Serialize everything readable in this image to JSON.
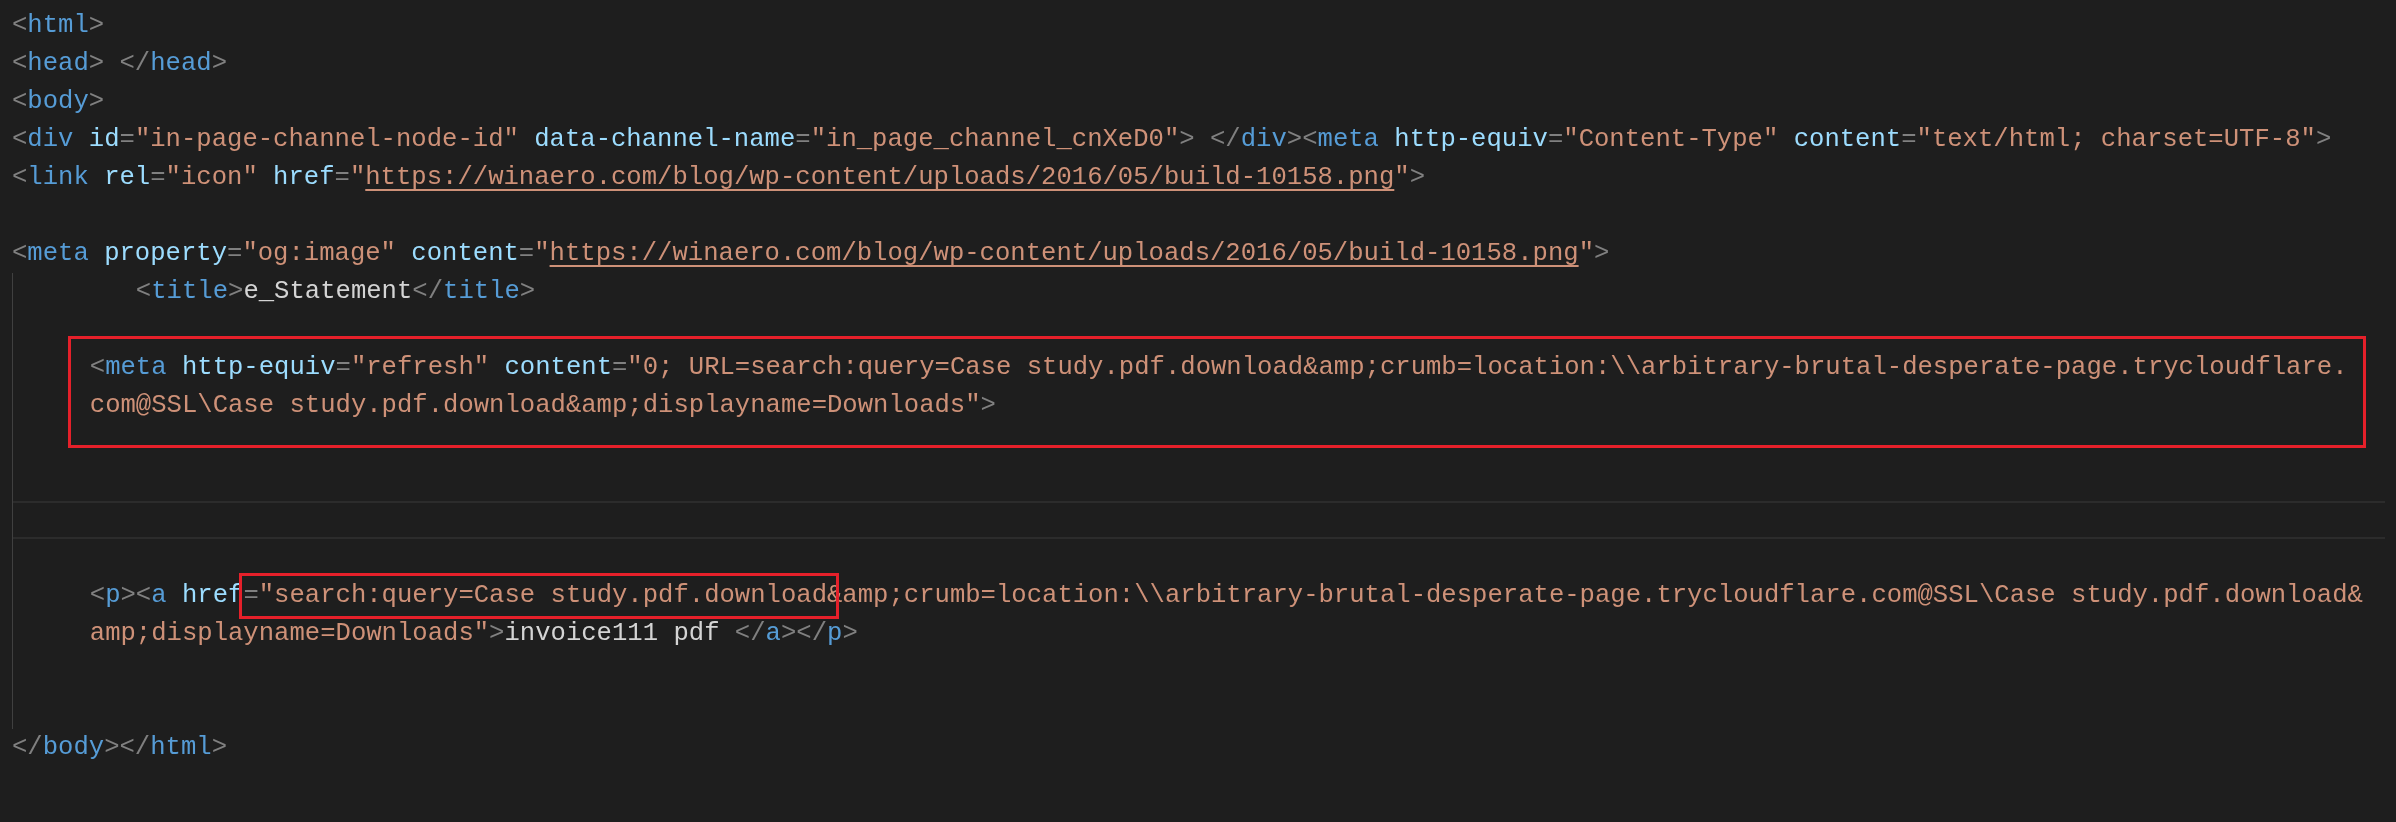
{
  "editor": {
    "lines": [
      {
        "kind": "flush",
        "tokens": [
          {
            "kind": "punct",
            "text": "<"
          },
          {
            "kind": "tag",
            "text": "html"
          },
          {
            "kind": "punct",
            "text": ">"
          }
        ]
      },
      {
        "kind": "flush",
        "tokens": [
          {
            "kind": "punct",
            "text": "<"
          },
          {
            "kind": "tag",
            "text": "head"
          },
          {
            "kind": "punct",
            "text": "> </"
          },
          {
            "kind": "tag",
            "text": "head"
          },
          {
            "kind": "punct",
            "text": ">"
          }
        ]
      },
      {
        "kind": "flush",
        "tokens": [
          {
            "kind": "punct",
            "text": "<"
          },
          {
            "kind": "tag",
            "text": "body"
          },
          {
            "kind": "punct",
            "text": ">"
          }
        ]
      },
      {
        "kind": "flush",
        "tokens": [
          {
            "kind": "punct",
            "text": "<"
          },
          {
            "kind": "tag",
            "text": "div"
          },
          {
            "kind": "attr",
            "text": " id"
          },
          {
            "kind": "punct",
            "text": "="
          },
          {
            "kind": "string",
            "text": "\"in-page-channel-node-id\""
          },
          {
            "kind": "attr",
            "text": " data-channel-name"
          },
          {
            "kind": "punct",
            "text": "="
          },
          {
            "kind": "string",
            "text": "\"in_page_channel_cnXeD0\""
          },
          {
            "kind": "punct",
            "text": "> </"
          },
          {
            "kind": "tag",
            "text": "div"
          },
          {
            "kind": "punct",
            "text": "><"
          },
          {
            "kind": "tag",
            "text": "meta"
          },
          {
            "kind": "attr",
            "text": " http-equiv"
          },
          {
            "kind": "punct",
            "text": "="
          },
          {
            "kind": "string",
            "text": "\"Content-Type\""
          },
          {
            "kind": "attr",
            "text": " content"
          },
          {
            "kind": "punct",
            "text": "="
          },
          {
            "kind": "string",
            "text": "\"text/html; charset=UTF-8\""
          },
          {
            "kind": "punct",
            "text": ">"
          }
        ]
      },
      {
        "kind": "flush",
        "tokens": [
          {
            "kind": "punct",
            "text": "<"
          },
          {
            "kind": "tag",
            "text": "link"
          },
          {
            "kind": "attr",
            "text": " rel"
          },
          {
            "kind": "punct",
            "text": "="
          },
          {
            "kind": "string",
            "text": "\"icon\""
          },
          {
            "kind": "attr",
            "text": " href"
          },
          {
            "kind": "punct",
            "text": "="
          },
          {
            "kind": "string",
            "text": "\""
          },
          {
            "kind": "url",
            "text": "https://winaero.com/blog/wp-content/uploads/2016/05/build-10158.png"
          },
          {
            "kind": "string",
            "text": "\""
          },
          {
            "kind": "punct",
            "text": ">"
          }
        ]
      },
      {
        "kind": "blank"
      },
      {
        "kind": "flush",
        "tokens": [
          {
            "kind": "punct",
            "text": "<"
          },
          {
            "kind": "tag",
            "text": "meta"
          },
          {
            "kind": "attr",
            "text": " property"
          },
          {
            "kind": "punct",
            "text": "="
          },
          {
            "kind": "string",
            "text": "\"og:image\""
          },
          {
            "kind": "attr",
            "text": " content"
          },
          {
            "kind": "punct",
            "text": "="
          },
          {
            "kind": "string",
            "text": "\""
          },
          {
            "kind": "url",
            "text": "https://winaero.com/blog/wp-content/uploads/2016/05/build-10158.png"
          },
          {
            "kind": "string",
            "text": "\""
          },
          {
            "kind": "punct",
            "text": ">"
          }
        ]
      },
      {
        "kind": "guide_block",
        "lines": [
          {
            "kind": "deep",
            "tokens": [
              {
                "kind": "punct",
                "text": "<"
              },
              {
                "kind": "tag",
                "text": "title"
              },
              {
                "kind": "punct",
                "text": ">"
              },
              {
                "kind": "text",
                "text": "e_Statement"
              },
              {
                "kind": "punct",
                "text": "</"
              },
              {
                "kind": "tag",
                "text": "title"
              },
              {
                "kind": "punct",
                "text": ">"
              }
            ]
          },
          {
            "kind": "blank"
          },
          {
            "kind": "annotated",
            "lines": [
              {
                "kind": "shallow",
                "tokens": [
                  {
                    "kind": "punct",
                    "text": "<"
                  },
                  {
                    "kind": "tag",
                    "text": "meta"
                  },
                  {
                    "kind": "attr",
                    "text": " http-equiv"
                  },
                  {
                    "kind": "punct",
                    "text": "="
                  },
                  {
                    "kind": "string",
                    "text": "\"refresh\""
                  },
                  {
                    "kind": "attr",
                    "text": " content"
                  },
                  {
                    "kind": "punct",
                    "text": "="
                  },
                  {
                    "kind": "string",
                    "text": "\"0; URL=search:query=Case study.pdf.download&amp;crumb=location:\\\\arbitrary-brutal-desperate-page.trycloudflare."
                  }
                ]
              },
              {
                "kind": "shallow",
                "tokens": [
                  {
                    "kind": "string",
                    "text": "com@SSL\\Case study.pdf.download&amp;displayname=Downloads\""
                  },
                  {
                    "kind": "punct",
                    "text": ">"
                  }
                ]
              }
            ]
          },
          {
            "kind": "blank"
          },
          {
            "kind": "blank"
          },
          {
            "kind": "cursor"
          },
          {
            "kind": "blank"
          },
          {
            "kind": "shallow",
            "tokens": [
              {
                "kind": "punct",
                "text": "<"
              },
              {
                "kind": "tag",
                "text": "p"
              },
              {
                "kind": "punct",
                "text": "><"
              },
              {
                "kind": "tag",
                "text": "a"
              },
              {
                "kind": "attr",
                "text": " href"
              },
              {
                "kind": "boxed",
                "tokens": [
                  {
                    "kind": "punct",
                    "text": "="
                  },
                  {
                    "kind": "string",
                    "text": "\"search:query=Case study.pdf.download"
                  }
                ]
              },
              {
                "kind": "string",
                "text": "&amp;crumb=location:\\\\arbitrary-brutal-desperate-page.trycloudflare.com@SSL\\Case study.pdf.download&"
              }
            ]
          },
          {
            "kind": "shallow",
            "tokens": [
              {
                "kind": "string",
                "text": "amp;displayname=Downloads\""
              },
              {
                "kind": "punct",
                "text": ">"
              },
              {
                "kind": "text",
                "text": "invoice111 pdf "
              },
              {
                "kind": "punct",
                "text": "</"
              },
              {
                "kind": "tag",
                "text": "a"
              },
              {
                "kind": "punct",
                "text": "></"
              },
              {
                "kind": "tag",
                "text": "p"
              },
              {
                "kind": "punct",
                "text": ">"
              }
            ]
          },
          {
            "kind": "blank"
          },
          {
            "kind": "blank"
          }
        ]
      },
      {
        "kind": "flush",
        "tokens": [
          {
            "kind": "punct",
            "text": "</"
          },
          {
            "kind": "tag",
            "text": "body"
          },
          {
            "kind": "punct",
            "text": "></"
          },
          {
            "kind": "tag",
            "text": "html"
          },
          {
            "kind": "punct",
            "text": ">"
          }
        ]
      }
    ]
  }
}
